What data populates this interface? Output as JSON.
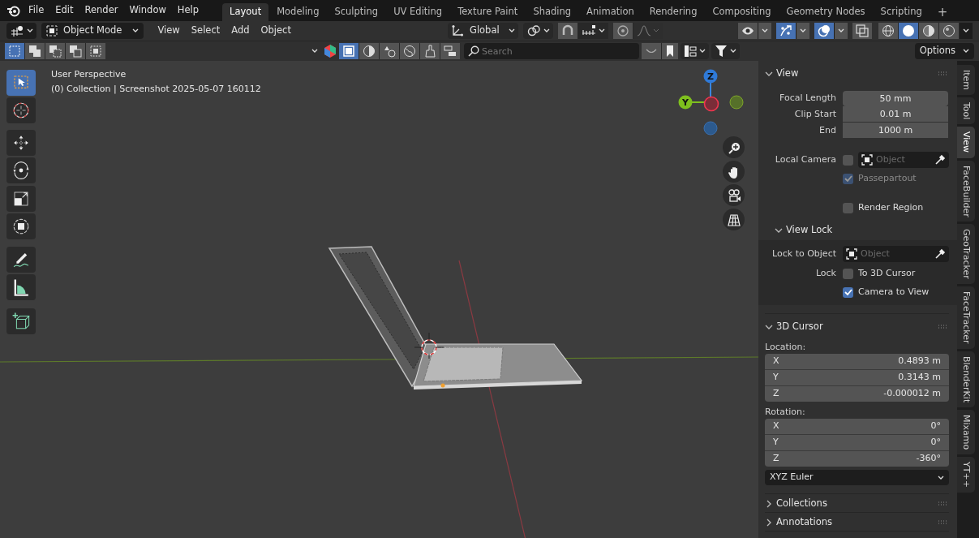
{
  "topbar": {
    "menus": [
      "File",
      "Edit",
      "Render",
      "Window",
      "Help"
    ],
    "workspaces": [
      {
        "label": "Layout",
        "selected": true
      },
      {
        "label": "Modeling",
        "selected": false
      },
      {
        "label": "Sculpting",
        "selected": false
      },
      {
        "label": "UV Editing",
        "selected": false
      },
      {
        "label": "Texture Paint",
        "selected": false
      },
      {
        "label": "Shading",
        "selected": false
      },
      {
        "label": "Animation",
        "selected": false
      },
      {
        "label": "Rendering",
        "selected": false
      },
      {
        "label": "Compositing",
        "selected": false
      },
      {
        "label": "Geometry Nodes",
        "selected": false
      },
      {
        "label": "Scripting",
        "selected": false
      }
    ],
    "add_workspace": "+"
  },
  "header": {
    "mode": "Object Mode",
    "menus": [
      "View",
      "Select",
      "Add",
      "Object"
    ],
    "orientation": "Global",
    "toggles": [
      {
        "kind": "visibility",
        "on": false
      },
      {
        "kind": "gizmo",
        "on": true
      },
      {
        "kind": "overlay",
        "on": true
      },
      {
        "kind": "xray",
        "on": false
      }
    ],
    "shading": [
      {
        "kind": "wireframe",
        "selected": false
      },
      {
        "kind": "solid",
        "selected": true
      },
      {
        "kind": "material",
        "selected": false
      },
      {
        "kind": "rendered",
        "selected": false
      }
    ]
  },
  "tool_header": {
    "select_modes": [
      {
        "selected": true
      },
      {
        "selected": false
      },
      {
        "selected": false
      },
      {
        "selected": false
      },
      {
        "selected": false
      }
    ],
    "filters": [
      {
        "kind": "object",
        "selected": true
      },
      {
        "kind": "data",
        "selected": false
      },
      {
        "kind": "material",
        "selected": false
      },
      {
        "kind": "world",
        "selected": false
      },
      {
        "kind": "texture",
        "selected": false
      },
      {
        "kind": "properties",
        "selected": false
      }
    ],
    "search": {
      "placeholder": "Search"
    },
    "options": "Options"
  },
  "toolbar": {
    "tools": [
      {
        "kind": "select",
        "selected": true
      },
      {
        "kind": "cursor",
        "selected": false
      },
      {
        "kind": "move",
        "selected": false
      },
      {
        "kind": "rotate",
        "selected": false
      },
      {
        "kind": "scale",
        "selected": false
      },
      {
        "kind": "transform",
        "selected": false
      },
      {
        "kind": "annotate",
        "selected": false
      },
      {
        "kind": "measure",
        "selected": false
      },
      {
        "kind": "add_cube",
        "selected": false
      }
    ]
  },
  "viewport": {
    "perspective": "User Perspective",
    "info": "(0) Collection | Screenshot 2025-05-07 160112",
    "gizmo_labels": [
      "Z",
      "Y"
    ]
  },
  "sidebar": {
    "tabs": [
      {
        "label": "Item",
        "selected": false
      },
      {
        "label": "Tool",
        "selected": false
      },
      {
        "label": "View",
        "selected": true
      },
      {
        "label": "FaceBuilder",
        "selected": false
      },
      {
        "label": "GeoTracker",
        "selected": false
      },
      {
        "label": "FaceTracker",
        "selected": false
      },
      {
        "label": "BlenderKit",
        "selected": false
      },
      {
        "label": "Mixamo",
        "selected": false
      },
      {
        "label": "YT++",
        "selected": false
      }
    ],
    "panels": [
      {
        "title": "View",
        "expanded": true,
        "rows": [
          {
            "kind": "number",
            "label": "Focal Length",
            "value": "50 mm"
          },
          {
            "kind": "number",
            "label": "Clip Start",
            "value": "0.01 m"
          },
          {
            "kind": "number",
            "label": "End",
            "value": "1000 m"
          },
          {
            "kind": "camera",
            "label": "Local Camera",
            "checked": false,
            "placeholder": "Object"
          },
          {
            "kind": "check",
            "text": "Passepartout",
            "checked": true,
            "disabled": true
          },
          {
            "kind": "check",
            "text": "Render Region",
            "checked": false,
            "disabled": false
          },
          {
            "kind": "subpanel",
            "title": "View Lock",
            "expanded": true,
            "rows": [
              {
                "kind": "object",
                "label": "Lock to Object",
                "placeholder": "Object"
              },
              {
                "kind": "lock",
                "label": "Lock",
                "text": "To 3D Cursor",
                "checked": false
              },
              {
                "kind": "check",
                "text": "Camera to View",
                "checked": true,
                "disabled": false
              }
            ]
          }
        ]
      },
      {
        "title": "3D Cursor",
        "expanded": true,
        "rows": [
          {
            "kind": "caption",
            "text": "Location:"
          },
          {
            "kind": "vector",
            "items": [
              {
                "axis": "X",
                "value": "0.4893 m"
              },
              {
                "axis": "Y",
                "value": "0.3143 m"
              },
              {
                "axis": "Z",
                "value": "-0.000012 m"
              }
            ]
          },
          {
            "kind": "caption",
            "text": "Rotation:"
          },
          {
            "kind": "vector",
            "items": [
              {
                "axis": "X",
                "value": "0°"
              },
              {
                "axis": "Y",
                "value": "0°"
              },
              {
                "axis": "Z",
                "value": "-360°"
              }
            ]
          },
          {
            "kind": "dropdown",
            "value": "XYZ Euler"
          }
        ]
      },
      {
        "title": "Collections",
        "expanded": false
      },
      {
        "title": "Annotations",
        "expanded": false
      }
    ]
  }
}
